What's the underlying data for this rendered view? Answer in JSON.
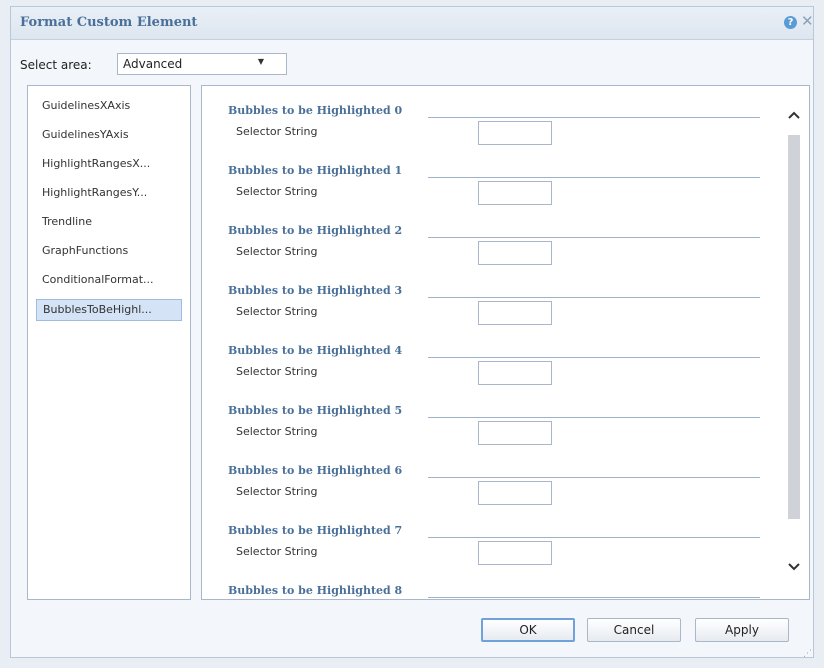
{
  "dialog": {
    "title": "Format Custom Element",
    "help_icon": "?",
    "close_icon": "✕"
  },
  "area": {
    "label": "Select area:",
    "value": "Advanced",
    "arrow": "▼"
  },
  "left_items": [
    {
      "label": "GuidelinesXAxis",
      "selected": false
    },
    {
      "label": "GuidelinesYAxis",
      "selected": false
    },
    {
      "label": "HighlightRangesX...",
      "selected": false
    },
    {
      "label": "HighlightRangesY...",
      "selected": false
    },
    {
      "label": "Trendline",
      "selected": false
    },
    {
      "label": "GraphFunctions",
      "selected": false
    },
    {
      "label": "ConditionalFormat...",
      "selected": false
    },
    {
      "label": "BubblesToBeHighl...",
      "selected": true
    }
  ],
  "sections": [
    {
      "title": "Bubbles to be Highlighted 0",
      "field_label": "Selector String",
      "value": ""
    },
    {
      "title": "Bubbles to be Highlighted 1",
      "field_label": "Selector String",
      "value": ""
    },
    {
      "title": "Bubbles to be Highlighted 2",
      "field_label": "Selector String",
      "value": ""
    },
    {
      "title": "Bubbles to be Highlighted 3",
      "field_label": "Selector String",
      "value": ""
    },
    {
      "title": "Bubbles to be Highlighted 4",
      "field_label": "Selector String",
      "value": ""
    },
    {
      "title": "Bubbles to be Highlighted 5",
      "field_label": "Selector String",
      "value": ""
    },
    {
      "title": "Bubbles to be Highlighted 6",
      "field_label": "Selector String",
      "value": ""
    },
    {
      "title": "Bubbles to be Highlighted 7",
      "field_label": "Selector String",
      "value": ""
    },
    {
      "title": "Bubbles to be Highlighted 8",
      "field_label": "",
      "value": ""
    }
  ],
  "scrollbar": {
    "up": "^",
    "down": "v"
  },
  "buttons": {
    "ok": "OK",
    "cancel": "Cancel",
    "apply": "Apply"
  },
  "colors": {
    "accent": "#4a7099",
    "selection": "#d4e3f5",
    "primary_border": "#6fa2d8"
  },
  "icons": {
    "help": "help-icon",
    "close": "close-icon",
    "dropdown": "chevron-down-icon",
    "scroll_up": "chevron-up-icon",
    "scroll_down": "chevron-down-icon",
    "resize": "resize-grip-icon"
  }
}
